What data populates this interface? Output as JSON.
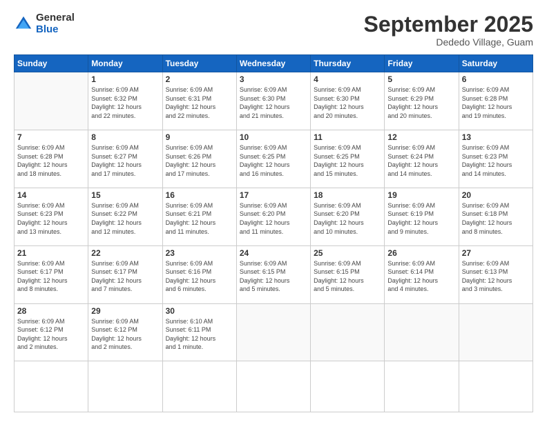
{
  "logo": {
    "general": "General",
    "blue": "Blue"
  },
  "header": {
    "month": "September 2025",
    "location": "Dededo Village, Guam"
  },
  "weekdays": [
    "Sunday",
    "Monday",
    "Tuesday",
    "Wednesday",
    "Thursday",
    "Friday",
    "Saturday"
  ],
  "days": [
    {
      "num": "",
      "info": ""
    },
    {
      "num": "1",
      "info": "Sunrise: 6:09 AM\nSunset: 6:32 PM\nDaylight: 12 hours\nand 22 minutes."
    },
    {
      "num": "2",
      "info": "Sunrise: 6:09 AM\nSunset: 6:31 PM\nDaylight: 12 hours\nand 22 minutes."
    },
    {
      "num": "3",
      "info": "Sunrise: 6:09 AM\nSunset: 6:30 PM\nDaylight: 12 hours\nand 21 minutes."
    },
    {
      "num": "4",
      "info": "Sunrise: 6:09 AM\nSunset: 6:30 PM\nDaylight: 12 hours\nand 20 minutes."
    },
    {
      "num": "5",
      "info": "Sunrise: 6:09 AM\nSunset: 6:29 PM\nDaylight: 12 hours\nand 20 minutes."
    },
    {
      "num": "6",
      "info": "Sunrise: 6:09 AM\nSunset: 6:28 PM\nDaylight: 12 hours\nand 19 minutes."
    },
    {
      "num": "7",
      "info": "Sunrise: 6:09 AM\nSunset: 6:28 PM\nDaylight: 12 hours\nand 18 minutes."
    },
    {
      "num": "8",
      "info": "Sunrise: 6:09 AM\nSunset: 6:27 PM\nDaylight: 12 hours\nand 17 minutes."
    },
    {
      "num": "9",
      "info": "Sunrise: 6:09 AM\nSunset: 6:26 PM\nDaylight: 12 hours\nand 17 minutes."
    },
    {
      "num": "10",
      "info": "Sunrise: 6:09 AM\nSunset: 6:25 PM\nDaylight: 12 hours\nand 16 minutes."
    },
    {
      "num": "11",
      "info": "Sunrise: 6:09 AM\nSunset: 6:25 PM\nDaylight: 12 hours\nand 15 minutes."
    },
    {
      "num": "12",
      "info": "Sunrise: 6:09 AM\nSunset: 6:24 PM\nDaylight: 12 hours\nand 14 minutes."
    },
    {
      "num": "13",
      "info": "Sunrise: 6:09 AM\nSunset: 6:23 PM\nDaylight: 12 hours\nand 14 minutes."
    },
    {
      "num": "14",
      "info": "Sunrise: 6:09 AM\nSunset: 6:23 PM\nDaylight: 12 hours\nand 13 minutes."
    },
    {
      "num": "15",
      "info": "Sunrise: 6:09 AM\nSunset: 6:22 PM\nDaylight: 12 hours\nand 12 minutes."
    },
    {
      "num": "16",
      "info": "Sunrise: 6:09 AM\nSunset: 6:21 PM\nDaylight: 12 hours\nand 11 minutes."
    },
    {
      "num": "17",
      "info": "Sunrise: 6:09 AM\nSunset: 6:20 PM\nDaylight: 12 hours\nand 11 minutes."
    },
    {
      "num": "18",
      "info": "Sunrise: 6:09 AM\nSunset: 6:20 PM\nDaylight: 12 hours\nand 10 minutes."
    },
    {
      "num": "19",
      "info": "Sunrise: 6:09 AM\nSunset: 6:19 PM\nDaylight: 12 hours\nand 9 minutes."
    },
    {
      "num": "20",
      "info": "Sunrise: 6:09 AM\nSunset: 6:18 PM\nDaylight: 12 hours\nand 8 minutes."
    },
    {
      "num": "21",
      "info": "Sunrise: 6:09 AM\nSunset: 6:17 PM\nDaylight: 12 hours\nand 8 minutes."
    },
    {
      "num": "22",
      "info": "Sunrise: 6:09 AM\nSunset: 6:17 PM\nDaylight: 12 hours\nand 7 minutes."
    },
    {
      "num": "23",
      "info": "Sunrise: 6:09 AM\nSunset: 6:16 PM\nDaylight: 12 hours\nand 6 minutes."
    },
    {
      "num": "24",
      "info": "Sunrise: 6:09 AM\nSunset: 6:15 PM\nDaylight: 12 hours\nand 5 minutes."
    },
    {
      "num": "25",
      "info": "Sunrise: 6:09 AM\nSunset: 6:15 PM\nDaylight: 12 hours\nand 5 minutes."
    },
    {
      "num": "26",
      "info": "Sunrise: 6:09 AM\nSunset: 6:14 PM\nDaylight: 12 hours\nand 4 minutes."
    },
    {
      "num": "27",
      "info": "Sunrise: 6:09 AM\nSunset: 6:13 PM\nDaylight: 12 hours\nand 3 minutes."
    },
    {
      "num": "28",
      "info": "Sunrise: 6:09 AM\nSunset: 6:12 PM\nDaylight: 12 hours\nand 2 minutes."
    },
    {
      "num": "29",
      "info": "Sunrise: 6:09 AM\nSunset: 6:12 PM\nDaylight: 12 hours\nand 2 minutes."
    },
    {
      "num": "30",
      "info": "Sunrise: 6:10 AM\nSunset: 6:11 PM\nDaylight: 12 hours\nand 1 minute."
    },
    {
      "num": "",
      "info": ""
    },
    {
      "num": "",
      "info": ""
    },
    {
      "num": "",
      "info": ""
    },
    {
      "num": "",
      "info": ""
    }
  ]
}
